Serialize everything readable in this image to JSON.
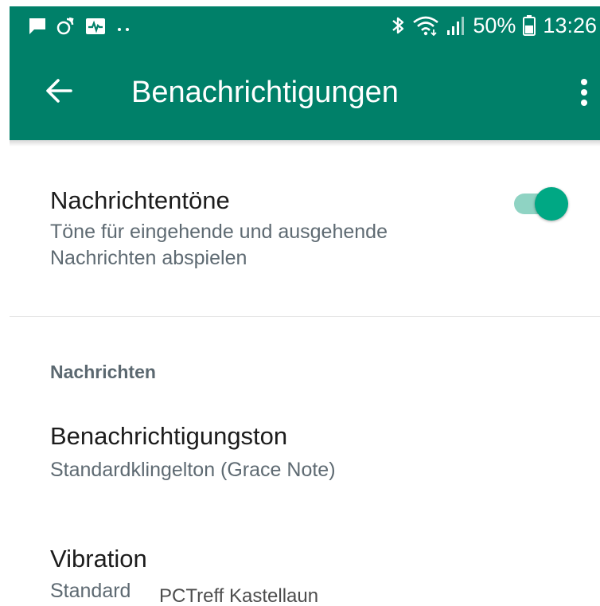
{
  "status_bar": {
    "left_icons": [
      "message-icon",
      "sync-icon",
      "activity-icon",
      "more-dots-icon"
    ],
    "right_icons": [
      "bluetooth-icon",
      "wifi-icon",
      "signal-icon",
      "battery-icon"
    ],
    "battery_text": "50%",
    "time": "13:26"
  },
  "toolbar": {
    "title": "Benachrichtigungen",
    "back_icon": "arrow-left-icon",
    "menu_icon": "more-vertical-icon",
    "background_color": "#008069"
  },
  "conversation_tones": {
    "title": "Nachrichtentöne",
    "subtitle_line1": "Töne für eingehende und ausgehende",
    "subtitle_line2": "Nachrichten abspielen",
    "enabled": true,
    "accent_color": "#00a884"
  },
  "messages_section": {
    "header": "Nachrichten",
    "notification_tone": {
      "title": "Benachrichtigungston",
      "value": "Standardklingelton (Grace Note)"
    },
    "vibration": {
      "title": "Vibration",
      "value": "Standard"
    }
  },
  "watermark": "PCTreff Kastellaun"
}
